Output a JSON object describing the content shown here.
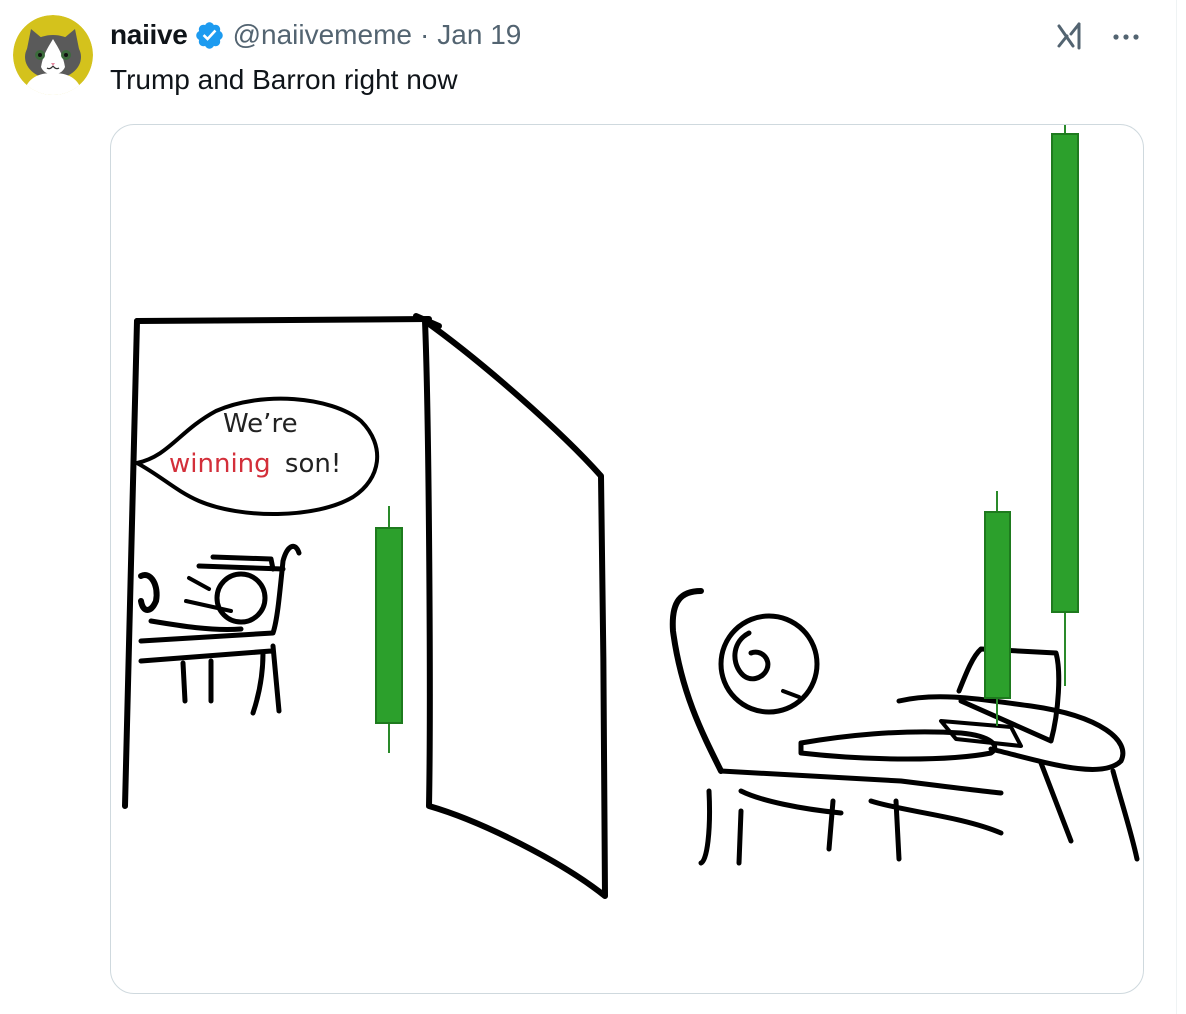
{
  "author": {
    "name": "naiive",
    "handle": "@naiivememe",
    "date": "Jan 19",
    "separator": "·",
    "verified_color": "#1d9bf0",
    "avatar_icon": "cat-avatar-icon"
  },
  "tweet": {
    "text": "Trump and Barron right now"
  },
  "actions": {
    "grok_icon": "grok-icon",
    "more_icon": "more-dots-icon"
  },
  "media": {
    "speech_line1": "We’re",
    "speech_word_highlight": "winning",
    "speech_word_rest": "son!",
    "highlight_color": "#d32f3a",
    "candle_color": "#2ca02c"
  }
}
